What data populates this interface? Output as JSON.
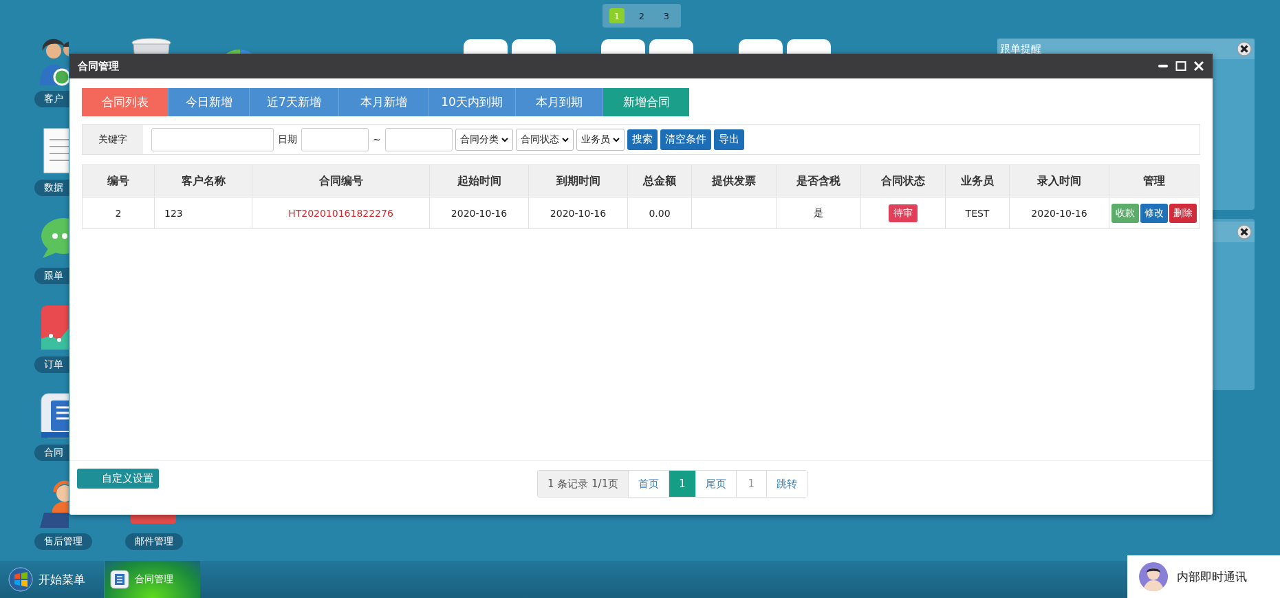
{
  "desktop": {
    "pages": [
      {
        "label": "1",
        "selected": true
      },
      {
        "label": "2",
        "selected": false
      },
      {
        "label": "3",
        "selected": false
      }
    ],
    "icon_columns": [
      [
        {
          "kind": "people",
          "label": "客户"
        },
        {
          "kind": "document",
          "label": "数据"
        },
        {
          "kind": "chat",
          "label": "跟单"
        },
        {
          "kind": "chart",
          "label": "订单"
        },
        {
          "kind": "contract",
          "label": "合同"
        },
        {
          "kind": "support",
          "label": "售后管理"
        }
      ],
      [
        {
          "kind": "trash"
        },
        {
          "kind": "mail",
          "label": "邮件管理"
        }
      ],
      [
        {
          "kind": "pie"
        }
      ]
    ],
    "reminder_panel": {
      "title": "跟单提醒"
    }
  },
  "window": {
    "title": "合同管理",
    "tabs": [
      {
        "label": "合同列表",
        "kind": "tab",
        "selected": true
      },
      {
        "label": "今日新增",
        "kind": "tab",
        "selected": false
      },
      {
        "label": "近7天新增",
        "kind": "tab",
        "selected": false
      },
      {
        "label": "本月新增",
        "kind": "tab",
        "selected": false
      },
      {
        "label": "10天内到期",
        "kind": "tab",
        "selected": false
      },
      {
        "label": "本月到期",
        "kind": "tab",
        "selected": false
      },
      {
        "label": "新增合同",
        "kind": "action",
        "selected": false
      }
    ],
    "filter": {
      "keyword_label": "关键字",
      "date_label": "日期",
      "range_separator": "~",
      "selects": [
        "合同分类",
        "合同状态",
        "业务员"
      ],
      "buttons": [
        "搜索",
        "清空条件",
        "导出"
      ]
    },
    "table": {
      "columns": [
        "编号",
        "客户名称",
        "合同编号",
        "起始时间",
        "到期时间",
        "总金额",
        "提供发票",
        "是否含税",
        "合同状态",
        "业务员",
        "录入时间",
        "管理"
      ],
      "rows": [
        {
          "id": "2",
          "customer": "123",
          "contract_no": "HT202010161822276",
          "start": "2020-10-16",
          "end": "2020-10-16",
          "amount": "0.00",
          "tax_included": "是",
          "status": {
            "label": "待审",
            "color": "#e0405a"
          },
          "salesperson": "TEST",
          "created": "2020-10-16",
          "actions": [
            {
              "label": "收款",
              "color": "#5cad6a"
            },
            {
              "label": "修改",
              "color": "#1f72b8"
            },
            {
              "label": "删除",
              "color": "#d12c3c"
            }
          ]
        }
      ]
    },
    "footer": {
      "settings_button": "自定义设置",
      "pagination": {
        "summary": "1 条记录 1/1页",
        "first": "首页",
        "pages": [
          {
            "label": "1",
            "selected": true
          }
        ],
        "last": "尾页",
        "jump_value": "1",
        "jump": "跳转"
      }
    }
  },
  "taskbar": {
    "start_label": "开始菜单",
    "tasks": [
      {
        "label": "合同管理",
        "selected": true
      }
    ],
    "chat_label": "内部即时通讯"
  }
}
